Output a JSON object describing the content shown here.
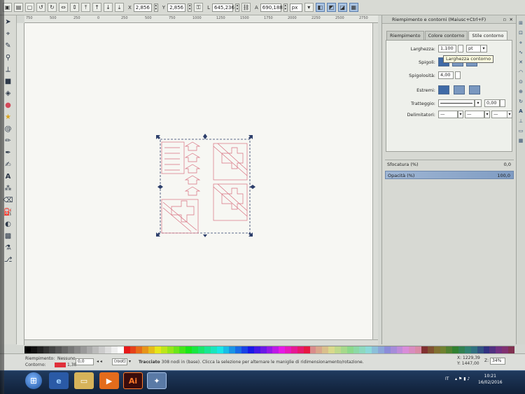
{
  "toolbar": {
    "x_label": "X",
    "x_value": "2,856",
    "y_label": "Y",
    "y_value": "2,856",
    "w_label": "L",
    "w_value": "645,236",
    "h_label": "A",
    "h_value": "690,188",
    "unit": "px"
  },
  "ruler": {
    "ticks": [
      "750",
      "500",
      "250",
      "0",
      "250",
      "500",
      "750",
      "1000",
      "1250",
      "1500",
      "1750",
      "2000",
      "2250",
      "2500",
      "2750"
    ]
  },
  "panel": {
    "title": "Riempimento e contorni (Maiusc+Ctrl+F)",
    "tabs": [
      {
        "label": "Riempimento"
      },
      {
        "label": "Colore contorno"
      },
      {
        "label": "Stile contorno"
      }
    ],
    "width_label": "Larghezza:",
    "width_value": "1,100",
    "width_unit": "pt",
    "tooltip": "Larghezza contorno",
    "joins_label": "Spigoli:",
    "miter_label": "Spigolosità:",
    "miter_value": "4,00",
    "caps_label": "Estremi:",
    "dashes_label": "Tratteggio:",
    "dash_offset": "0,00",
    "markers_label": "Delimitatori:",
    "blur_label": "Sfocatura (%)",
    "blur_value": "0,0",
    "opacity_label": "Opacità (%)",
    "opacity_value": "100,0"
  },
  "status": {
    "fill_label": "Riempimento:",
    "stroke_label": "Contorno:",
    "fill_value": "Nessuno",
    "stroke_width": "1,38",
    "opacity_value": "0,0",
    "layer": "(root)",
    "message_bold": "Tracciato",
    "message": " 308 nodi in (base). Clicca la selezione per alternare le maniglie di ridimensionamento/rotazione.",
    "coord_x": "X: 1229,39",
    "coord_y": "Y: 1447,00",
    "zoom_label": "Z:",
    "zoom_value": "34%"
  },
  "taskbar": {
    "lang": "IT",
    "time": "10:21",
    "date": "16/02/2016",
    "app_ai": "Ai"
  },
  "colors": {
    "selection": "#2c3e6a",
    "shape_stroke": "#d87080",
    "panel_accent": "#3f6aa6"
  }
}
